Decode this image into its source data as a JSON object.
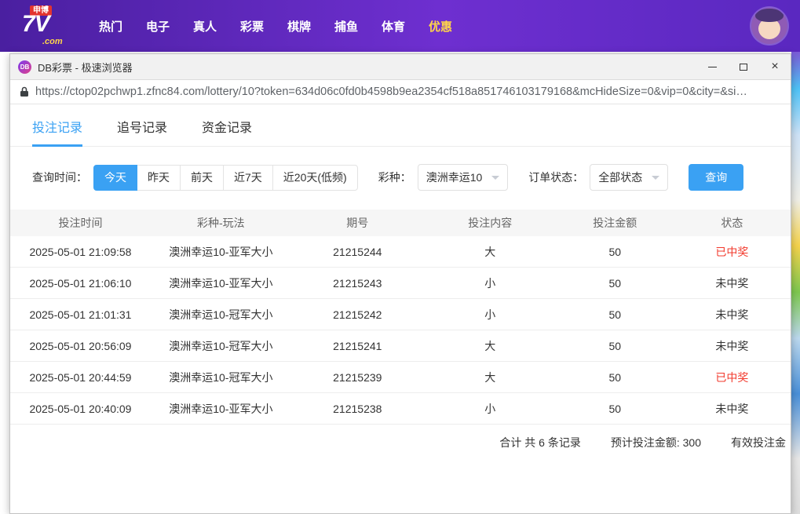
{
  "colors": {
    "accent": "#3aa1f3",
    "win-red": "#f2392c",
    "topbar-purple": "#5a28c0",
    "highlight-yellow": "#ffd54a",
    "brand-red": "#e3342f"
  },
  "top_nav": {
    "logo": {
      "tag": "申博",
      "main": "7V",
      "suffix": ".com"
    },
    "items": [
      {
        "label": "热门",
        "highlight": false
      },
      {
        "label": "电子",
        "highlight": false
      },
      {
        "label": "真人",
        "highlight": false
      },
      {
        "label": "彩票",
        "highlight": false
      },
      {
        "label": "棋牌",
        "highlight": false
      },
      {
        "label": "捕鱼",
        "highlight": false
      },
      {
        "label": "体育",
        "highlight": false
      },
      {
        "label": "优惠",
        "highlight": true
      }
    ]
  },
  "browser": {
    "icon_text": "DB",
    "title": "DB彩票 - 极速浏览器",
    "url": "https://ctop02pchwp1.zfnc84.com/lottery/10?token=634d06c0fd0b4598b9ea2354cf518a851746103179168&mcHideSize=0&vip=0&city=&si…"
  },
  "tabs": [
    {
      "label": "投注记录",
      "active": true
    },
    {
      "label": "追号记录",
      "active": false
    },
    {
      "label": "资金记录",
      "active": false
    }
  ],
  "filters": {
    "time_label": "查询时间：",
    "time_options": [
      "今天",
      "昨天",
      "前天",
      "近7天",
      "近20天(低频)"
    ],
    "active_time": "今天",
    "lottery_label": "彩种：",
    "lottery_value": "澳洲幸运10",
    "status_label": "订单状态：",
    "status_value": "全部状态",
    "query_button": "查询"
  },
  "table": {
    "headers": [
      "投注时间",
      "彩种-玩法",
      "期号",
      "投注内容",
      "投注金额",
      "状态"
    ],
    "rows": [
      {
        "time": "2025-05-01 21:09:58",
        "game": "澳洲幸运10-亚军大小",
        "issue": "21215244",
        "content": "大",
        "amount": "50",
        "status": "已中奖",
        "won": true
      },
      {
        "time": "2025-05-01 21:06:10",
        "game": "澳洲幸运10-亚军大小",
        "issue": "21215243",
        "content": "小",
        "amount": "50",
        "status": "未中奖",
        "won": false
      },
      {
        "time": "2025-05-01 21:01:31",
        "game": "澳洲幸运10-冠军大小",
        "issue": "21215242",
        "content": "小",
        "amount": "50",
        "status": "未中奖",
        "won": false
      },
      {
        "time": "2025-05-01 20:56:09",
        "game": "澳洲幸运10-冠军大小",
        "issue": "21215241",
        "content": "大",
        "amount": "50",
        "status": "未中奖",
        "won": false
      },
      {
        "time": "2025-05-01 20:44:59",
        "game": "澳洲幸运10-冠军大小",
        "issue": "21215239",
        "content": "大",
        "amount": "50",
        "status": "已中奖",
        "won": true
      },
      {
        "time": "2025-05-01 20:40:09",
        "game": "澳洲幸运10-亚军大小",
        "issue": "21215238",
        "content": "小",
        "amount": "50",
        "status": "未中奖",
        "won": false
      }
    ]
  },
  "summary": {
    "total": "合计 共 6 条记录",
    "expected": "预计投注金额: 300",
    "valid": "有效投注金"
  }
}
